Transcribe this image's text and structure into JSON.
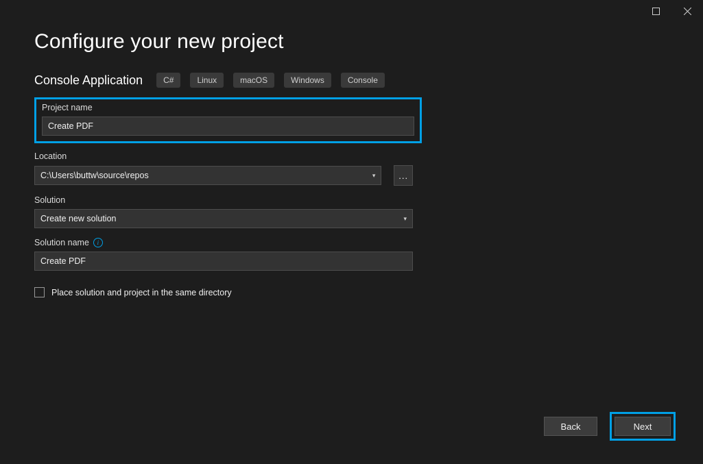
{
  "page": {
    "title": "Configure your new project",
    "subtitle": "Console Application"
  },
  "tags": [
    "C#",
    "Linux",
    "macOS",
    "Windows",
    "Console"
  ],
  "fields": {
    "projectName": {
      "label": "Project name",
      "value": "Create PDF"
    },
    "location": {
      "label": "Location",
      "value": "C:\\Users\\buttw\\source\\repos",
      "browse": "..."
    },
    "solution": {
      "label": "Solution",
      "value": "Create new solution"
    },
    "solutionName": {
      "label": "Solution name",
      "value": "Create PDF"
    }
  },
  "checkbox": {
    "sameDir": "Place solution and project in the same directory"
  },
  "buttons": {
    "back": "Back",
    "next": "Next"
  }
}
